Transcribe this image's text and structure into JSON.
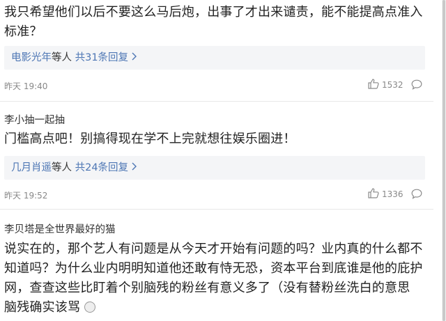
{
  "comments": [
    {
      "author": "",
      "text": "我只希望他们以后不要这么马后炮，出事了才出来谴责，能不能提高点准入标准？",
      "reply_user": "电影光年",
      "reply_mid": "等人",
      "reply_count": "共31条回复",
      "time": "昨天 19:40",
      "likes": "1532"
    },
    {
      "author": "李小抽一起抽",
      "text": "门槛高点吧！别搞得现在学不上完就想往娱乐圈进！",
      "reply_user": "几月肖遥",
      "reply_mid": "等人",
      "reply_count": "共24条回复",
      "time": "昨天 19:52",
      "likes": "1336"
    },
    {
      "author": "李贝塔是全世界最好的猫",
      "text": "说实在的，那个艺人有问题是从今天才开始有问题的吗？业内真的什么都不知道吗？为什么业内明明知道他还敢有恃无恐，资本平台到底谁是他的庇护网，查查这些比盯着个别脑残的粉丝有意义多了（没有替粉丝洗白的意思 脑残确实该骂"
    }
  ],
  "icons": {
    "like": "thumbs-up-icon",
    "reply": "comment-bubble-icon",
    "chevron": "chevron-right-icon",
    "emoji": "emoji-icon"
  },
  "colors": {
    "link": "#4d76b4",
    "meta": "#888888",
    "reply_bg": "#f4f5f7"
  }
}
